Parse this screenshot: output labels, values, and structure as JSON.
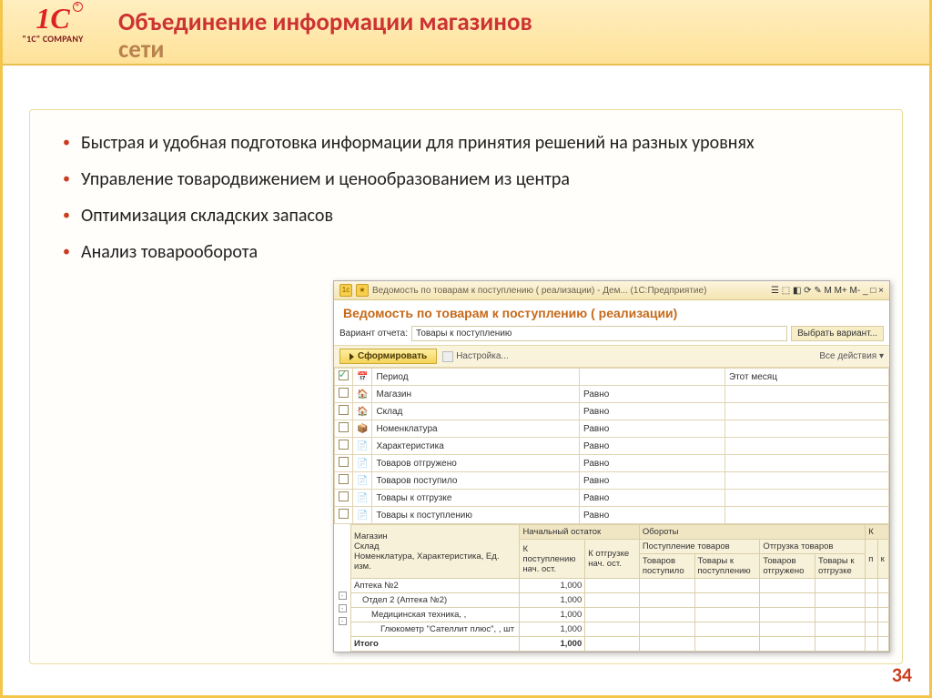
{
  "slide": {
    "title_line1": "Объединение информации магазинов",
    "title_line2": "сети",
    "logo_caption": "\"1C\" COMPANY",
    "page_number": "34",
    "bullets": [
      "Быстрая и удобная подготовка информации для принятия решений на разных уровнях",
      "Управление товародвижением и ценообразованием из центра",
      "Оптимизация складских запасов",
      "Анализ товарооборота"
    ]
  },
  "app": {
    "titlebar": "Ведомость по товарам к поступлению ( реализации) - Дем...   (1С:Предприятие)",
    "tb_icons": "☰ ⬚ ◧ ⟳ ✎ M M+ M-  _ □ ×",
    "header": "Ведомость по товарам к поступлению ( реализации)",
    "variant_label": "Вариант отчета:",
    "variant_value": "Товары к поступлению",
    "btn_select_variant": "Выбрать вариант...",
    "btn_form": "Сформировать",
    "lnk_settings": "Настройка...",
    "lnk_actions": "Все действия ▾",
    "filters": [
      {
        "checked": true,
        "icon": "📅",
        "name": "Период",
        "op": "",
        "val": "Этот месяц"
      },
      {
        "checked": false,
        "icon": "🏠",
        "name": "Магазин",
        "op": "Равно",
        "val": ""
      },
      {
        "checked": false,
        "icon": "🏠",
        "name": "Склад",
        "op": "Равно",
        "val": ""
      },
      {
        "checked": false,
        "icon": "📦",
        "name": "Номенклатура",
        "op": "Равно",
        "val": ""
      },
      {
        "checked": false,
        "icon": "📄",
        "name": "Характеристика",
        "op": "Равно",
        "val": ""
      },
      {
        "checked": false,
        "icon": "📄",
        "name": "Товаров отгружено",
        "op": "Равно",
        "val": ""
      },
      {
        "checked": false,
        "icon": "📄",
        "name": "Товаров поступило",
        "op": "Равно",
        "val": ""
      },
      {
        "checked": false,
        "icon": "📄",
        "name": "Товары к отгрузке",
        "op": "Равно",
        "val": ""
      },
      {
        "checked": false,
        "icon": "📄",
        "name": "Товары к поступлению",
        "op": "Равно",
        "val": ""
      }
    ],
    "grid": {
      "h1": {
        "c1": "Магазин",
        "c2": "Начальный остаток",
        "c3": "Обороты",
        "c4": "К"
      },
      "h2": {
        "c1": "Склад",
        "c2a": "К",
        "c2b": "К отгрузке",
        "c3a": "Поступление товаров",
        "c3b": "Отгрузка товаров",
        "c4": "К"
      },
      "h3": {
        "c1": "Номенклатура, Характеристика, Ед. изм.",
        "c2a": "поступлению нач. ост.",
        "c2b": "нач. ост.",
        "c3a": "Товаров поступило",
        "c3b": "Товары к поступлению",
        "c3c": "Товаров отгружено",
        "c3d": "Товары к отгрузке",
        "c4a": "п",
        "c4b": "к"
      },
      "rows": [
        {
          "label": "Аптека №2",
          "v": "1,000",
          "cls": ""
        },
        {
          "label": "Отдел 2 (Аптека №2)",
          "v": "1,000",
          "cls": "indent1"
        },
        {
          "label": "Медицинская техника, ,",
          "v": "1,000",
          "cls": "indent2"
        },
        {
          "label": "Глюкометр \"Сателлит плюс\", , шт",
          "v": "1,000",
          "cls": "indent3"
        }
      ],
      "total_label": "Итого",
      "total_value": "1,000"
    }
  }
}
